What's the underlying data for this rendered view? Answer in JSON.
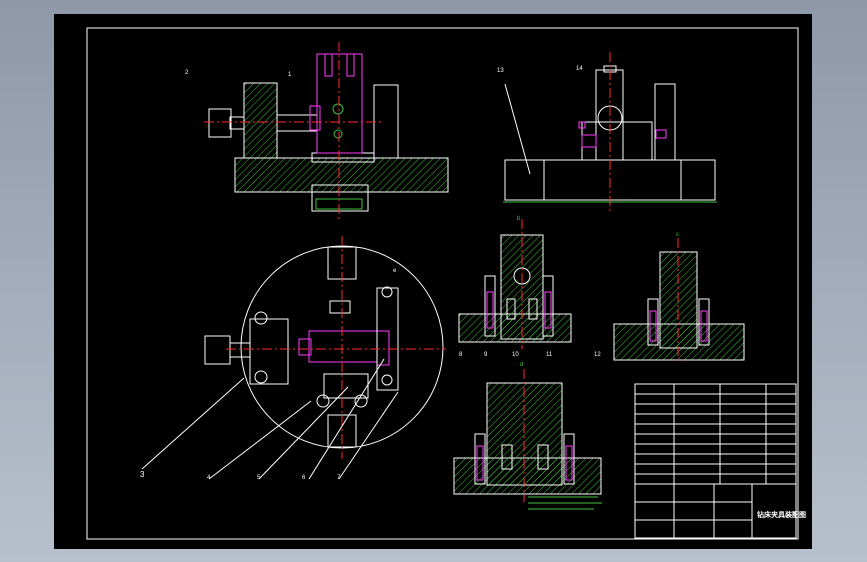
{
  "drawing": {
    "title_block": {
      "title": "钻床夹具装配图"
    },
    "balloons": [
      {
        "id": "balloon-1",
        "label": "1"
      },
      {
        "id": "balloon-2",
        "label": "2"
      },
      {
        "id": "balloon-3",
        "label": "3"
      },
      {
        "id": "balloon-4",
        "label": "4"
      },
      {
        "id": "balloon-5",
        "label": "5"
      },
      {
        "id": "balloon-6",
        "label": "6"
      },
      {
        "id": "balloon-7",
        "label": "7"
      },
      {
        "id": "balloon-8",
        "label": "8"
      },
      {
        "id": "balloon-9",
        "label": "9"
      },
      {
        "id": "balloon-10",
        "label": "10"
      },
      {
        "id": "balloon-11",
        "label": "11"
      },
      {
        "id": "balloon-12",
        "label": "12"
      },
      {
        "id": "balloon-13",
        "label": "13"
      },
      {
        "id": "balloon-14",
        "label": "14"
      }
    ],
    "section_labels": {
      "b": "b",
      "c": "c",
      "d": "d",
      "e": "e"
    }
  },
  "colors": {
    "background": "#000000",
    "outline": "#ffffff",
    "hatch": "#3fbf3f",
    "part_highlight": "#ff3cff",
    "centerline": "#ff2a2a",
    "text": "#e9e930"
  }
}
